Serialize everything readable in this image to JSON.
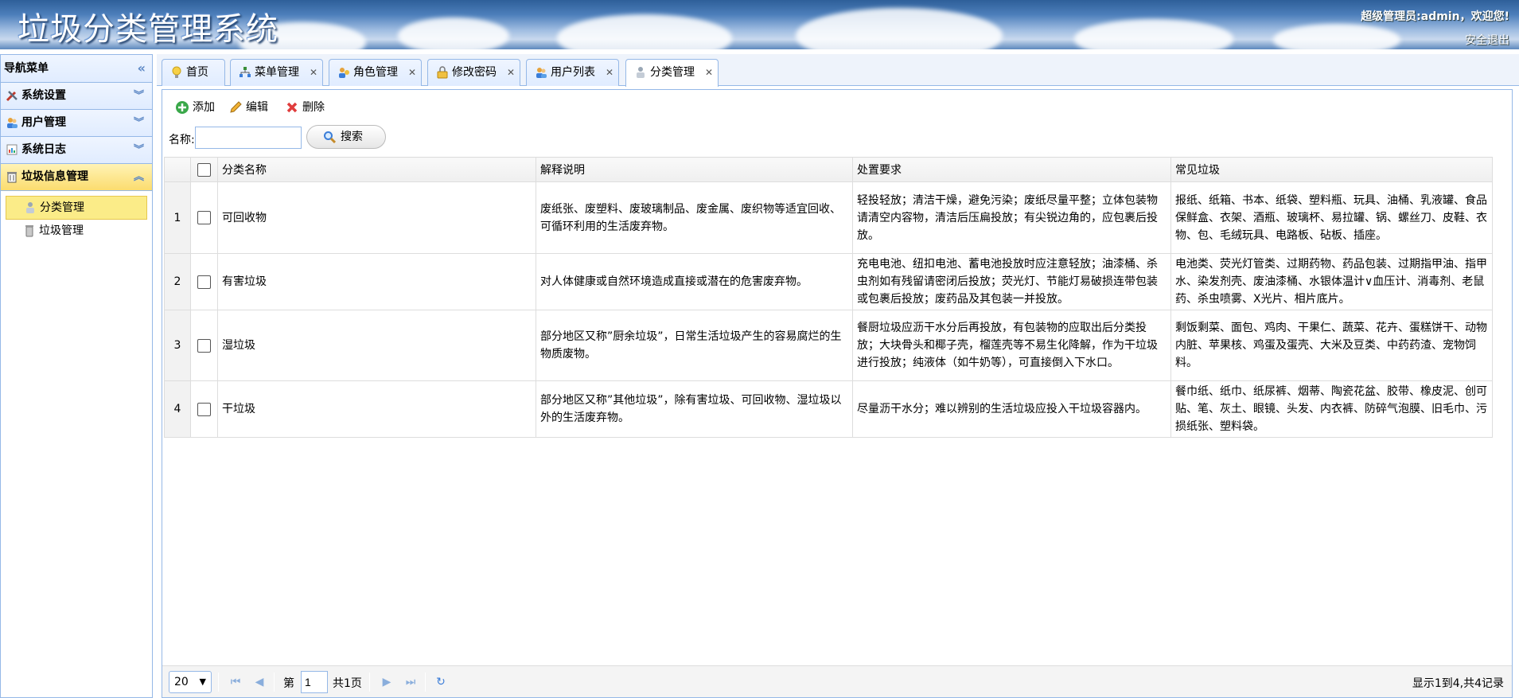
{
  "header": {
    "title": "垃圾分类管理系统",
    "user_info": "超级管理员:admin，欢迎您!",
    "logout": "安全退出"
  },
  "sidebar": {
    "title": "导航菜单",
    "sections": [
      {
        "label": "系统设置",
        "icon": "tools-icon"
      },
      {
        "label": "用户管理",
        "icon": "users-icon"
      },
      {
        "label": "系统日志",
        "icon": "log-icon"
      },
      {
        "label": "垃圾信息管理",
        "icon": "trash-icon"
      }
    ],
    "items": [
      {
        "label": "分类管理",
        "icon": "category-icon"
      },
      {
        "label": "垃圾管理",
        "icon": "bin-icon"
      }
    ]
  },
  "tabs": [
    {
      "label": "首页",
      "icon": "lightbulb-icon"
    },
    {
      "label": "菜单管理",
      "icon": "menu-tree-icon"
    },
    {
      "label": "角色管理",
      "icon": "role-icon"
    },
    {
      "label": "修改密码",
      "icon": "lock-icon"
    },
    {
      "label": "用户列表",
      "icon": "user-list-icon"
    },
    {
      "label": "分类管理",
      "icon": "category-icon"
    }
  ],
  "toolbar": {
    "add": "添加",
    "edit": "编辑",
    "delete": "删除",
    "search_label": "名称:",
    "search_value": "",
    "search_button": "搜索"
  },
  "table": {
    "columns": [
      "分类名称",
      "解释说明",
      "处置要求",
      "常见垃圾"
    ],
    "rows": [
      {
        "n": "1",
        "name": "可回收物",
        "desc": "废纸张、废塑料、废玻璃制品、废金属、废织物等适宜回收、可循环利用的生活废弃物。",
        "req": "轻投轻放；清洁干燥，避免污染；废纸尽量平整；立体包装物请清空内容物，清洁后压扁投放；有尖锐边角的，应包裹后投放。",
        "common": "报纸、纸箱、书本、纸袋、塑料瓶、玩具、油桶、乳液罐、食品保鲜盒、衣架、酒瓶、玻璃杯、易拉罐、锅、螺丝刀、皮鞋、衣物、包、毛绒玩具、电路板、砧板、插座。"
      },
      {
        "n": "2",
        "name": "有害垃圾",
        "desc": "对人体健康或自然环境造成直接或潜在的危害废弃物。",
        "req": "充电电池、纽扣电池、蓄电池投放时应注意轻放；油漆桶、杀虫剂如有残留请密闭后投放；荧光灯、节能灯易破损连带包装或包裹后投放；废药品及其包装一并投放。",
        "common": "电池类、荧光灯管类、过期药物、药品包装、过期指甲油、指甲水、染发剂壳、废油漆桶、水银体温计∨血压计、消毒剂、老鼠药、杀虫喷雾、X光片、相片底片。"
      },
      {
        "n": "3",
        "name": "湿垃圾",
        "desc": "部分地区又称”厨余垃圾”，日常生活垃圾产生的容易腐烂的生物质废物。",
        "req": "餐厨垃圾应沥干水分后再投放，有包装物的应取出后分类投放；大块骨头和椰子壳，榴莲壳等不易生化降解，作为干垃圾进行投放；纯液体（如牛奶等），可直接倒入下水口。",
        "common": "剩饭剩菜、面包、鸡肉、干果仁、蔬菜、花卉、蛋糕饼干、动物内脏、苹果核、鸡蛋及蛋壳、大米及豆类、中药药渣、宠物饲料。"
      },
      {
        "n": "4",
        "name": "干垃圾",
        "desc": "部分地区又称”其他垃圾”，除有害垃圾、可回收物、湿垃圾以外的生活废弃物。",
        "req": "尽量沥干水分；难以辨别的生活垃圾应投入干垃圾容器内。",
        "common": "餐巾纸、纸巾、纸尿裤、烟蒂、陶瓷花盆、胶带、橡皮泥、创可贴、笔、灰土、眼镜、头发、内衣裤、防碎气泡膜、旧毛巾、污损纸张、塑料袋。"
      }
    ]
  },
  "pager": {
    "page_size": "20",
    "page_prefix": "第",
    "page_value": "1",
    "page_total": "共1页",
    "info": "显示1到4,共4记录"
  }
}
